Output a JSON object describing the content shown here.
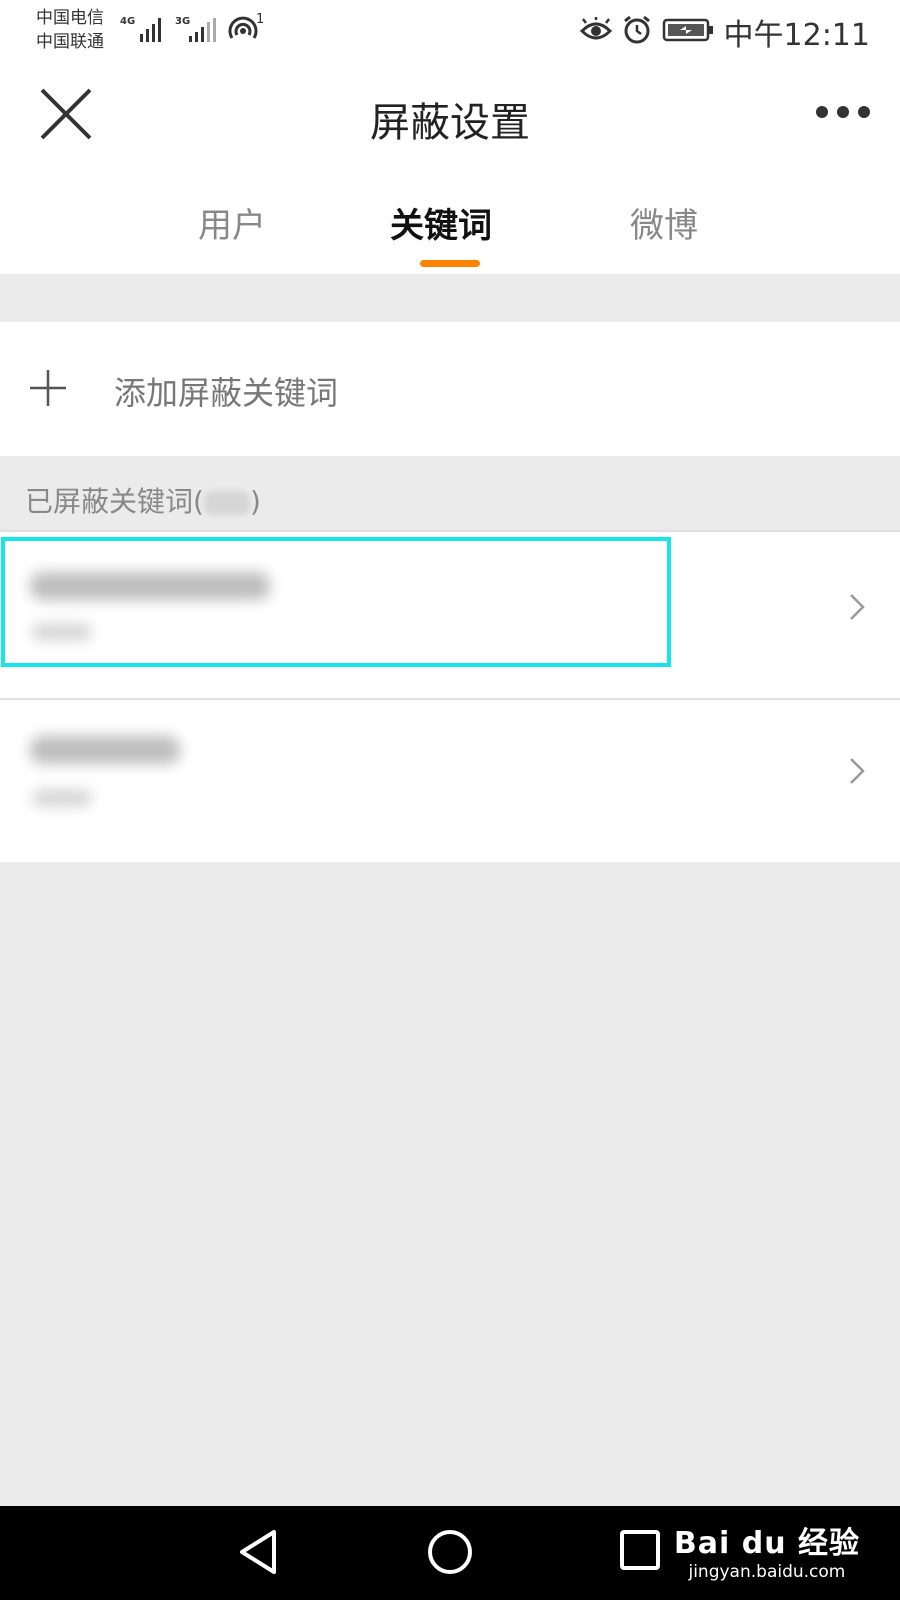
{
  "status_bar": {
    "carrier_1": "中国电信",
    "carrier_2": "中国联通",
    "network_1": "4G",
    "network_2": "3G",
    "hotspot_count": "1",
    "time": "中午12:11",
    "icons": [
      "eye-icon",
      "alarm-icon",
      "battery-icon",
      "hotspot-icon",
      "signal-icon"
    ]
  },
  "header": {
    "title": "屏蔽设置",
    "close_icon": "close-icon",
    "more_icon": "more-dots-icon"
  },
  "tabs": [
    {
      "label": "用户",
      "active": false
    },
    {
      "label": "关键词",
      "active": true
    },
    {
      "label": "微博",
      "active": false
    }
  ],
  "accent_color": "#ff8200",
  "add_row": {
    "label": "添加屏蔽关键词",
    "icon": "plus-icon"
  },
  "section": {
    "header_prefix": "已屏蔽关键词(",
    "header_suffix": ")"
  },
  "keyword_items": [
    {
      "blurred": true,
      "chevron": "chevron-right-icon"
    },
    {
      "blurred": true,
      "chevron": "chevron-right-icon"
    }
  ],
  "highlight_color": "#18e6e6",
  "system_nav": {
    "keys": [
      "back-icon",
      "home-icon",
      "recents-icon"
    ]
  },
  "watermark": {
    "logo": "Bai du 经验",
    "url": "jingyan.baidu.com"
  }
}
